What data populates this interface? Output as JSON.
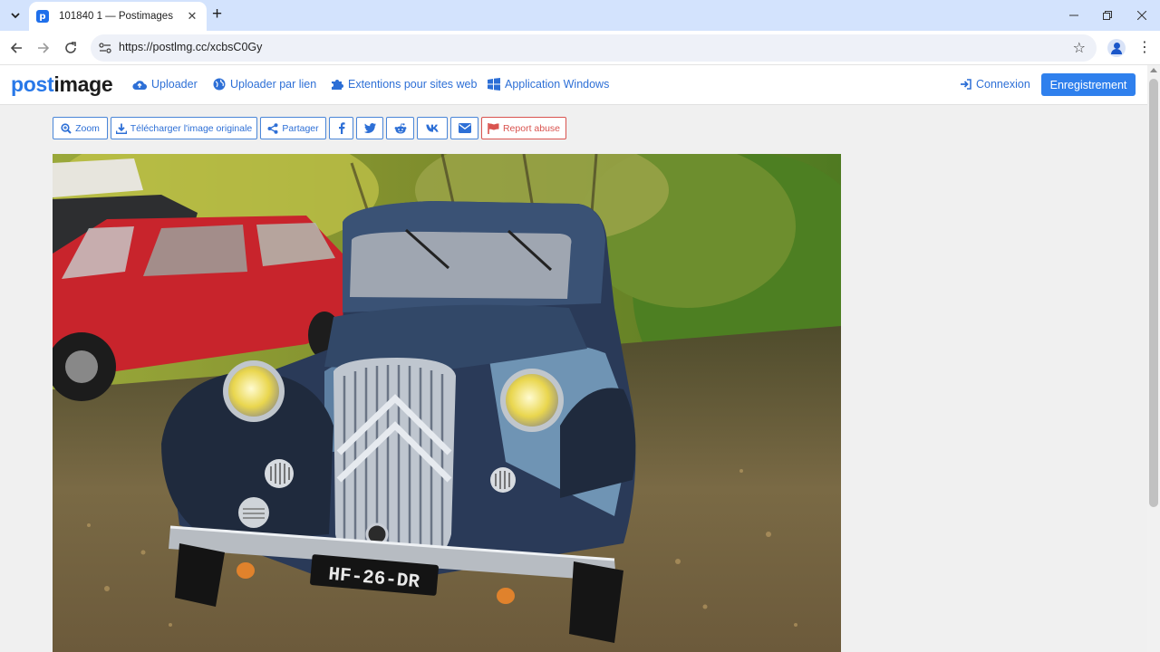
{
  "browser": {
    "tab_title": "101840 1 — Postimages",
    "favicon_letter": "p",
    "url": "https://postlmg.cc/xcbsC0Gy"
  },
  "site": {
    "logo_part1": "post",
    "logo_part2": "image",
    "nav": {
      "uploader": "Uploader",
      "uploader_link": "Uploader par lien",
      "extensions": "Extentions pour sites web",
      "windows_app": "Application Windows",
      "login": "Connexion",
      "register": "Enregistrement"
    },
    "accent_color": "#2f80ed"
  },
  "actions": {
    "zoom": "Zoom",
    "download": "Télécharger l'image originale",
    "share": "Partager",
    "report": "Report abuse"
  },
  "image": {
    "plate": "HF-26-DR"
  }
}
